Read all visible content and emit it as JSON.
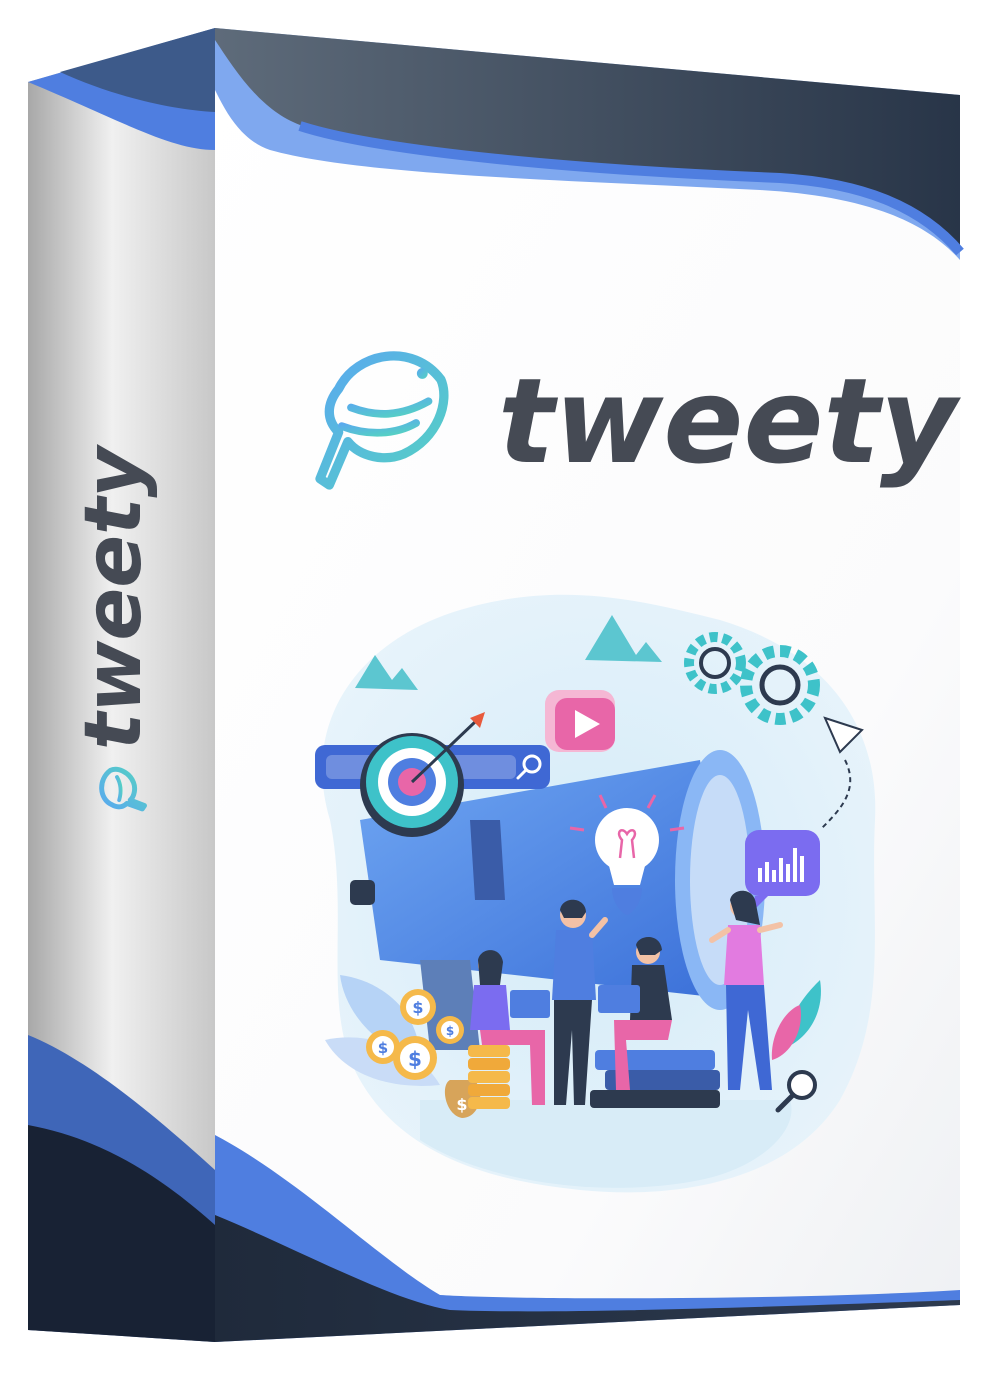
{
  "product": {
    "brand_name": "tweety",
    "spine_brand_name": "tweety"
  },
  "icons": {
    "front_logo": "bird-logo-icon",
    "spine_logo": "bird-logo-icon",
    "search": "search-icon",
    "target": "target-icon",
    "video": "play-icon",
    "lightbulb": "lightbulb-icon",
    "gears": "gear-icon",
    "analytics": "chart-bubble-icon",
    "paper_plane": "paper-plane-icon",
    "coins": "dollar-coin-icon",
    "money_bag": "money-bag-icon",
    "magnifier": "magnifier-icon"
  },
  "colors": {
    "navy": "#2d3a4f",
    "blue": "#4f7ee0",
    "light_blue": "#7fa8ef",
    "logo_gradient_start": "#5aa8f0",
    "logo_gradient_end": "#5ad0c8",
    "text_dark": "#454a54",
    "pink": "#e866a8",
    "teal": "#3ec2c9"
  }
}
